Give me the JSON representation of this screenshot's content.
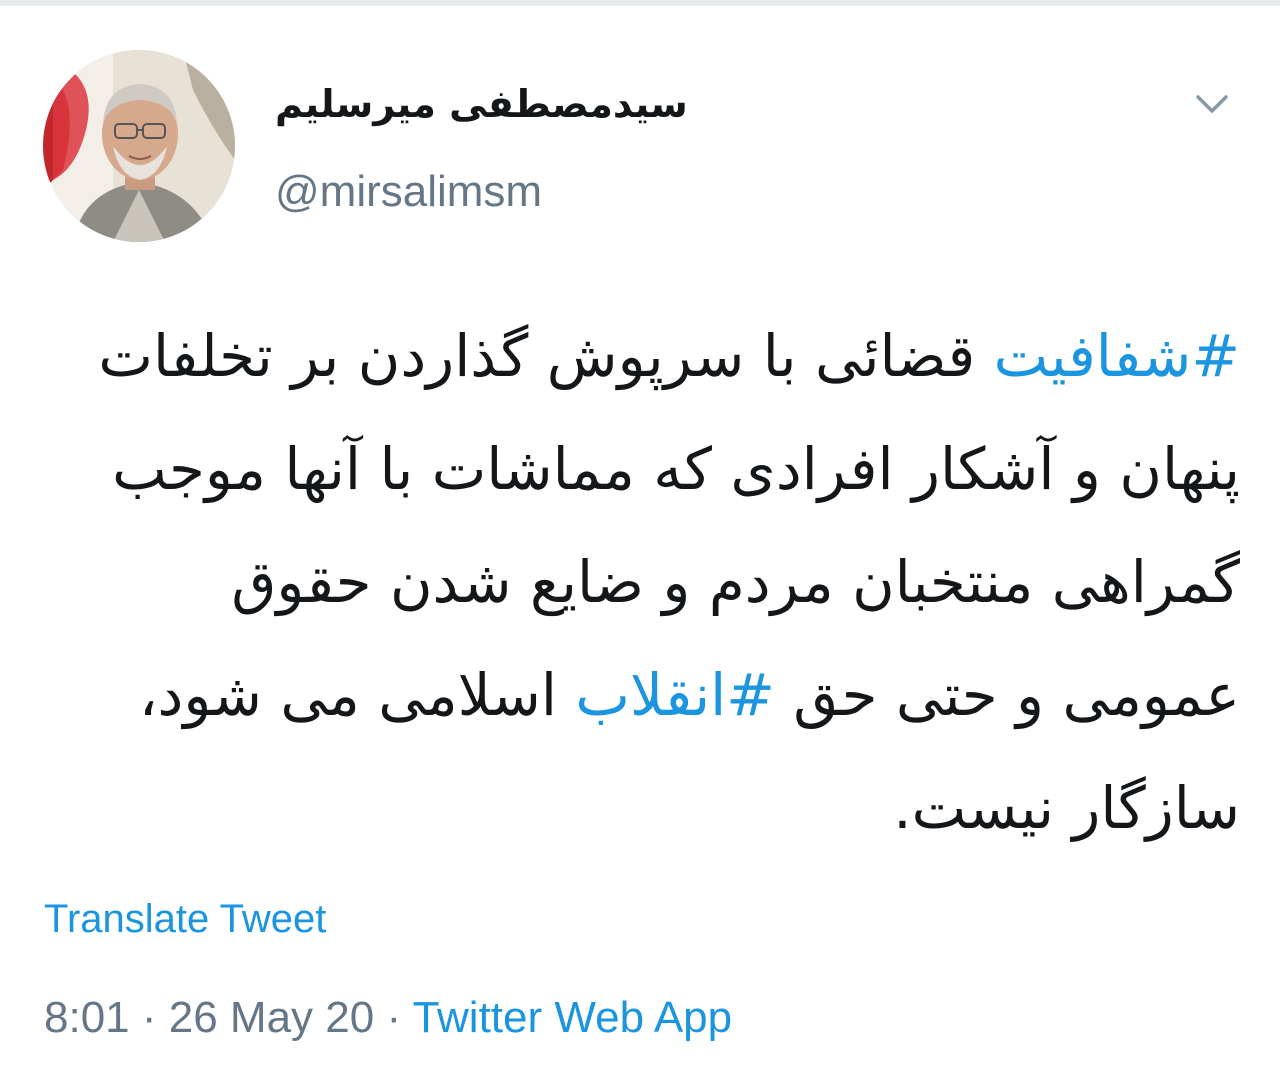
{
  "tweet": {
    "display_name": "سیدمصطفی میرسلیم",
    "handle": "@mirsalimsm",
    "text_segments": [
      {
        "text": "#شفافیت",
        "hashtag": true
      },
      {
        "text": " قضائی با سرپوش گذاردن بر تخلفات پنهان و آشکار افرادی که مماشات با آنها موجب گمراهی منتخبان مردم و ضایع شدن حقوق عمومی و حتی حق ",
        "hashtag": false
      },
      {
        "text": "#انقلاب",
        "hashtag": true
      },
      {
        "text": " اسلامی می شود، سازگار نیست.",
        "hashtag": false
      }
    ],
    "translate_label": "Translate Tweet",
    "time": "8:01",
    "separator": "·",
    "date": "26 May 20",
    "source": "Twitter Web App"
  },
  "icons": {
    "caret": "chevron-down-icon",
    "avatar": "profile-avatar"
  },
  "colors": {
    "link": "#1b95e0",
    "secondary_text": "#657786",
    "primary_text": "#14171a",
    "border": "#e6ecf0"
  }
}
